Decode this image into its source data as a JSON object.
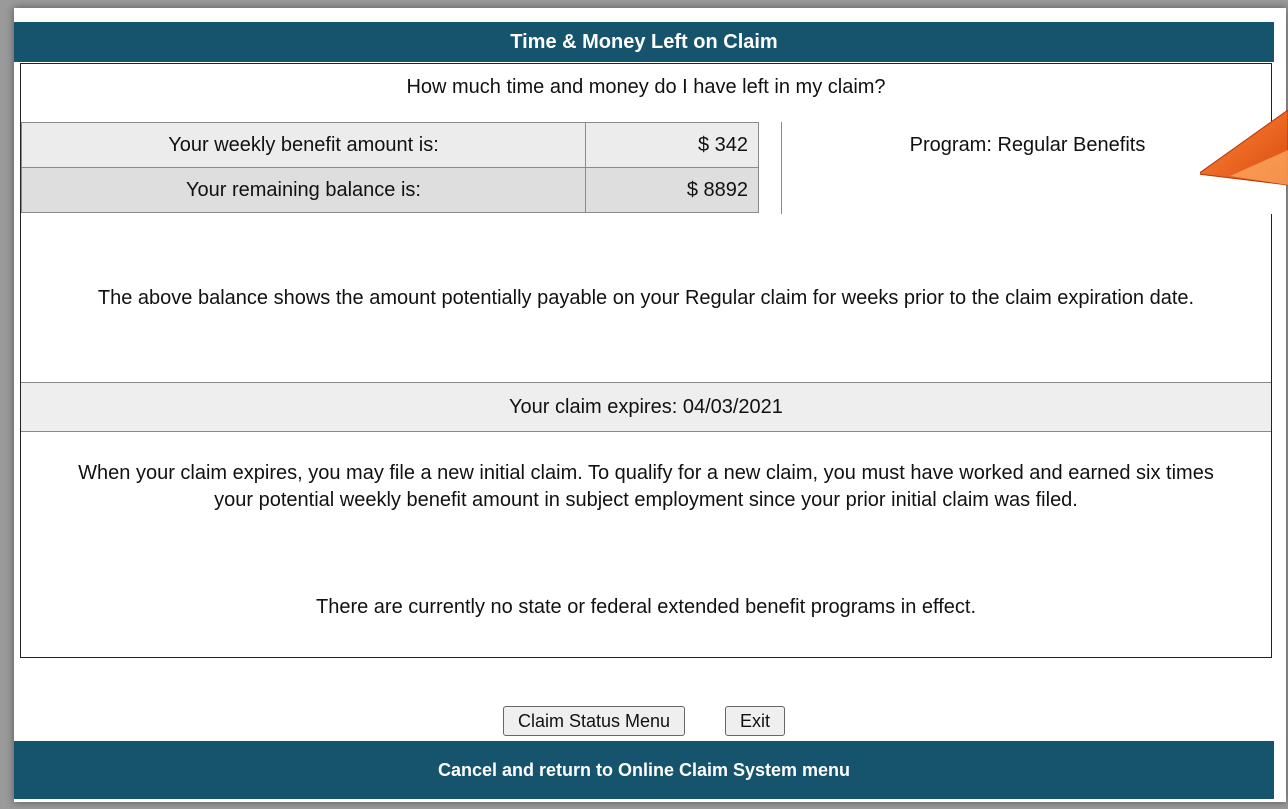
{
  "header": {
    "title": "Time & Money Left on Claim"
  },
  "question": "How much time and money do I have left in my claim?",
  "benefits": {
    "weekly_label": "Your weekly benefit amount is:",
    "weekly_value": "$ 342",
    "balance_label": "Your remaining balance is:",
    "balance_value": "$ 8892",
    "program": "Program: Regular Benefits"
  },
  "balance_note": "The above balance shows the amount potentially payable on your Regular claim for weeks prior to the claim expiration date.",
  "expires": "Your claim expires: 04/03/2021",
  "expire_info": "When your claim expires, you may file a new initial claim. To qualify for a new claim, you must have worked and earned six times your potential weekly benefit amount in subject employment since your prior initial claim was filed.",
  "no_programs": "There are currently no state or federal extended benefit programs in effect.",
  "buttons": {
    "claim_status": "Claim Status Menu",
    "exit": "Exit"
  },
  "footer": {
    "link": "Cancel and return to Online Claim System menu"
  },
  "colors": {
    "header_bg": "#16536d",
    "arrow": "#f26522"
  },
  "icons": {
    "annotation_arrow": "arrow-icon"
  }
}
